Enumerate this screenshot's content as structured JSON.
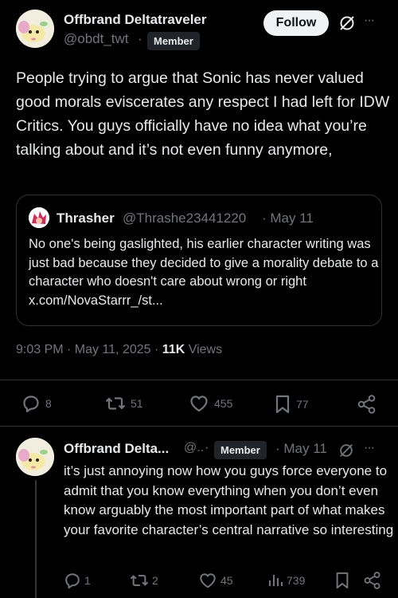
{
  "main_tweet": {
    "display_name": "Offbrand Deltatraveler",
    "handle": "@obdt_twt",
    "separator": "·",
    "badge": "Member",
    "follow_label": "Follow",
    "more": "···",
    "text": "People trying to argue that Sonic has never valued good morals eviscerates any respect I had left for IDW Critics. You guys officially have no idea what you’re talking about and it’s not even funny anymore,",
    "quoted": {
      "display_name": "Thrasher",
      "handle": "@Thrashe23441220",
      "date": "· May 11",
      "text": "No one's being gaslighted, his earlier character writing was just bad because they decided to give a morality debate to a character who doesn't care about wrong or right x.com/NovaStarrr_/st..."
    },
    "timestamp": "9:03 PM · May 11, 2025 · ",
    "views_count": "11K",
    "views_label": " Views",
    "actions": {
      "replies": "8",
      "reposts": "51",
      "likes": "455",
      "bookmarks": "77"
    }
  },
  "reply_tweet": {
    "display_name": "Offbrand Delta...",
    "handle": "@..",
    "separator": "·",
    "badge": "Member",
    "date": "· May 11",
    "more": "···",
    "text": "it’s just annoying now how you guys force everyone to admit that you know everything when you don’t even know arguably the most important part of what makes your favorite character’s central narrative so interesting",
    "actions": {
      "replies": "1",
      "reposts": "2",
      "likes": "45",
      "views": "739"
    }
  },
  "icons": [
    "reply-icon",
    "repost-icon",
    "like-icon",
    "bookmark-icon",
    "share-icon",
    "views-icon",
    "grok-icon",
    "more-icon"
  ],
  "colors": {
    "background": "#000000",
    "text": "#e7e9ea",
    "muted": "#71767b",
    "border": "#2f3336",
    "button": "#eff3f4"
  }
}
